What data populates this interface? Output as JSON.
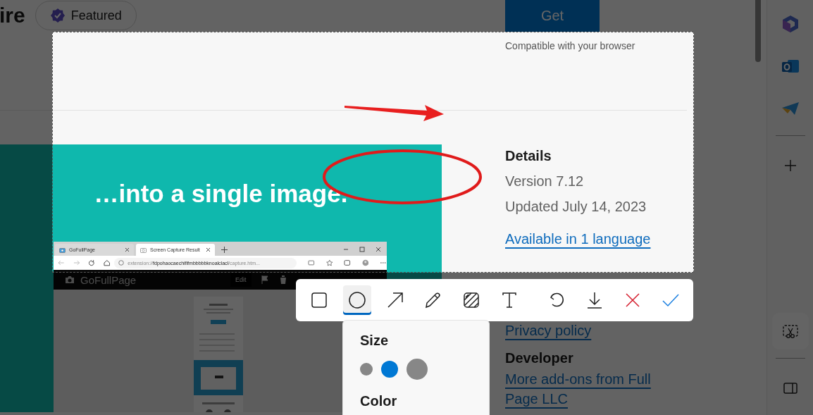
{
  "page": {
    "title_fragment": "ire",
    "badge": "Featured",
    "get_button": "Get",
    "compatibility": "Compatible with your browser"
  },
  "promo": {
    "headline": "…into a single image.",
    "browser": {
      "tabs": [
        {
          "label": "GoFullPage",
          "selected": false
        },
        {
          "label": "Screen Capture Result",
          "selected": true
        }
      ],
      "url_scheme": "extension://",
      "url_id": "fdpohaocaechififmbbbbbknoalclacl",
      "url_path": "/capture.htm...",
      "app_name": "GoFullPage",
      "edit_button": "Edit"
    }
  },
  "details": {
    "heading": "Details",
    "version": "Version 7.12",
    "updated": "Updated July 14, 2023",
    "languages_link": "Available in 1 language",
    "privacy_link": "Privacy policy"
  },
  "developer": {
    "heading": "Developer",
    "link": "More add-ons from Full Page LLC"
  },
  "sidebar": {
    "items": [
      {
        "kind": "office",
        "selected": false
      },
      {
        "kind": "outlook",
        "selected": false
      },
      {
        "kind": "plane",
        "selected": false
      },
      {
        "kind": "add",
        "selected": false
      },
      {
        "kind": "screenshot",
        "selected": true
      },
      {
        "kind": "panel",
        "selected": false
      }
    ]
  },
  "annotations": [
    {
      "kind": "arrow"
    },
    {
      "kind": "ellipse"
    }
  ],
  "toolbar": {
    "tools": [
      {
        "kind": "rectangle",
        "selected": false
      },
      {
        "kind": "ellipse",
        "selected": true
      },
      {
        "kind": "arrow",
        "selected": false
      },
      {
        "kind": "pen",
        "selected": false
      },
      {
        "kind": "blur",
        "selected": false
      },
      {
        "kind": "text",
        "selected": false
      }
    ],
    "actions": [
      {
        "kind": "undo"
      },
      {
        "kind": "download"
      },
      {
        "kind": "cancel"
      },
      {
        "kind": "confirm"
      }
    ]
  },
  "size_panel": {
    "size_label": "Size",
    "sizes": [
      {
        "kind": "small",
        "selected": false
      },
      {
        "kind": "medium",
        "selected": true
      },
      {
        "kind": "large",
        "selected": false
      }
    ],
    "color_label": "Color"
  }
}
